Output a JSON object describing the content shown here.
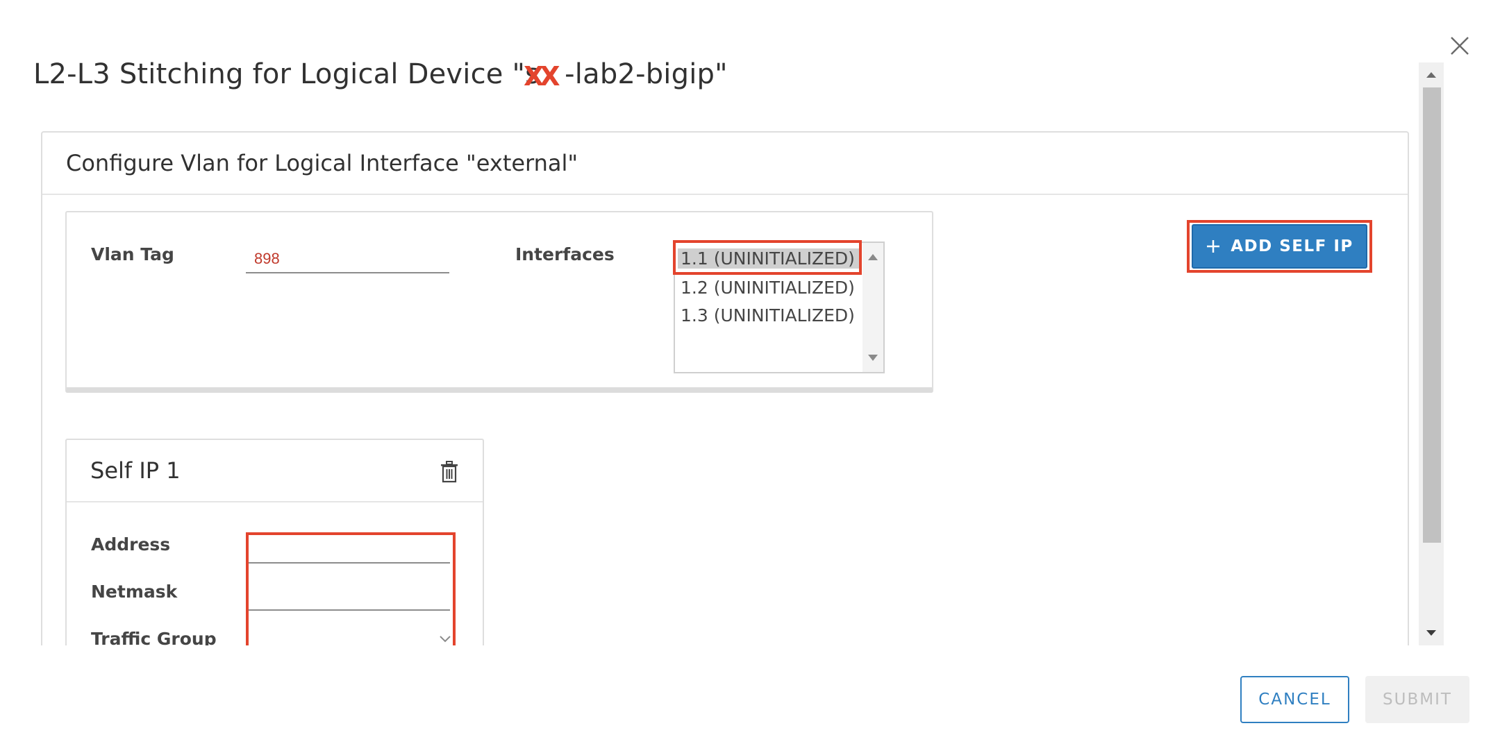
{
  "dialog": {
    "title": "L2-L3 Stitching for Logical Device \"s",
    "title_suffix": "-lab2-bigip\"",
    "redaction_text": "XX",
    "close_icon": "close-icon"
  },
  "vlan_section": {
    "header": "Configure Vlan for Logical Interface \"external\"",
    "vlan_tag_label": "Vlan Tag",
    "vlan_tag_value": "898",
    "interfaces_label": "Interfaces",
    "interfaces": [
      {
        "label": "1.1 (UNINITIALIZED)",
        "selected": true
      },
      {
        "label": "1.2 (UNINITIALIZED)",
        "selected": false
      },
      {
        "label": "1.3 (UNINITIALIZED)",
        "selected": false
      }
    ],
    "add_self_ip_label": "ADD SELF IP",
    "add_icon": "plus-icon"
  },
  "self_ip": {
    "title": "Self IP 1",
    "delete_icon": "trash-icon",
    "address_label": "Address",
    "address_value": "",
    "netmask_label": "Netmask",
    "netmask_value": "",
    "traffic_group_label": "Traffic Group",
    "traffic_group_value": ""
  },
  "footer": {
    "cancel_label": "CANCEL",
    "submit_label": "SUBMIT"
  },
  "colors": {
    "primary": "#2f7fc1",
    "highlight": "#e3442d",
    "disabled_bg": "#f0f0f0",
    "disabled_text": "#bdbdbd"
  }
}
